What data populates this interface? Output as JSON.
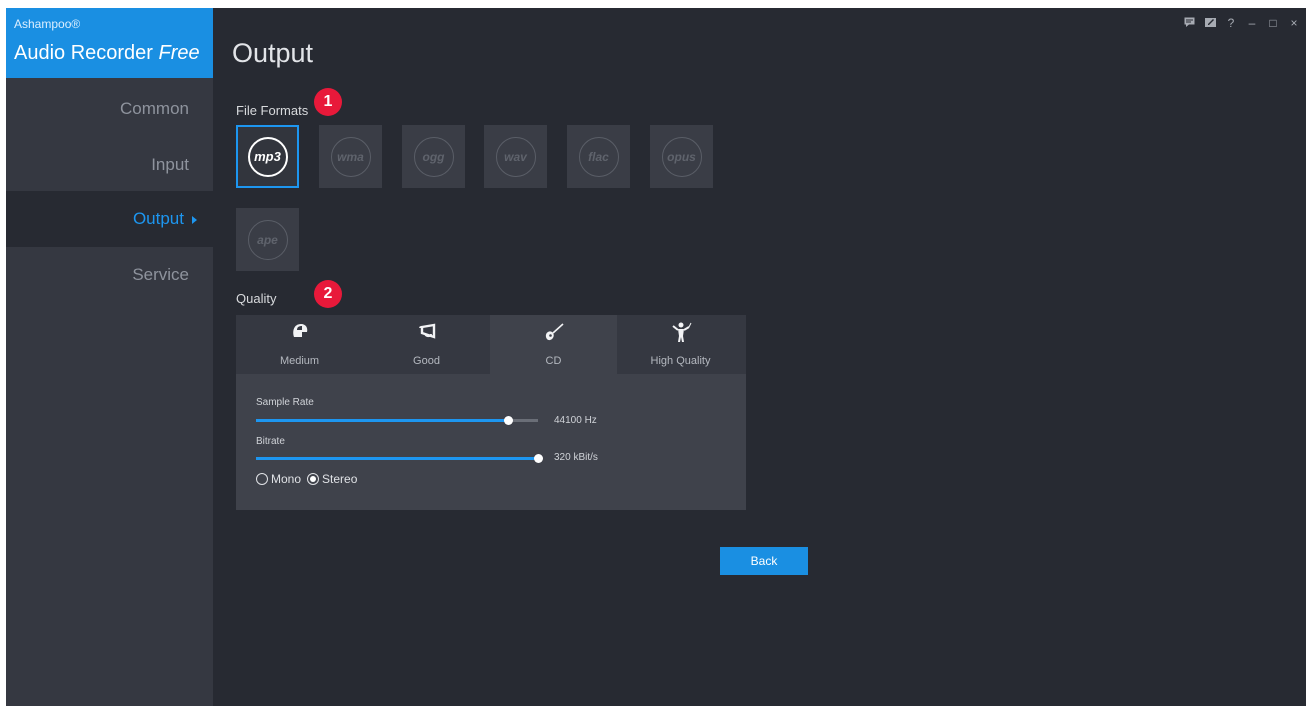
{
  "brand": {
    "company": "Ashampoo®",
    "product": "Audio Recorder",
    "edition": "Free"
  },
  "sidebar": {
    "items": [
      {
        "label": "Common"
      },
      {
        "label": "Input"
      },
      {
        "label": "Output"
      },
      {
        "label": "Service"
      }
    ],
    "active_item": "Output"
  },
  "window_controls": {
    "icons": [
      "feedback-icon",
      "edit-icon",
      "help-icon",
      "minimize-icon",
      "maximize-icon",
      "close-icon"
    ],
    "help": "?",
    "minimize": "–",
    "maximize": "□",
    "close": "×"
  },
  "page": {
    "title": "Output"
  },
  "file_formats": {
    "label": "File Formats",
    "badge": "1",
    "selected": "mp3",
    "formats": [
      "mp3",
      "wma",
      "ogg",
      "wav",
      "flac",
      "opus",
      "ape"
    ]
  },
  "quality": {
    "label": "Quality",
    "badge": "2",
    "tabs": [
      {
        "label": "Medium",
        "icon": "helmet-icon"
      },
      {
        "label": "Good",
        "icon": "horn-icon"
      },
      {
        "label": "CD",
        "icon": "guitar-icon"
      },
      {
        "label": "High Quality",
        "icon": "conductor-icon"
      }
    ],
    "active_tab": "CD",
    "sample_rate": {
      "label": "Sample Rate",
      "value_text": "44100 Hz",
      "fraction": 0.895
    },
    "bitrate": {
      "label": "Bitrate",
      "value_text": "320 kBit/s",
      "fraction": 1.0
    },
    "channels": {
      "options": [
        "Mono",
        "Stereo"
      ],
      "selected": "Stereo"
    }
  },
  "actions": {
    "back_label": "Back"
  },
  "colors": {
    "accent": "#1d96f0",
    "badge": "#e8193a",
    "background": "#272a32",
    "sidebar": "#353841"
  }
}
